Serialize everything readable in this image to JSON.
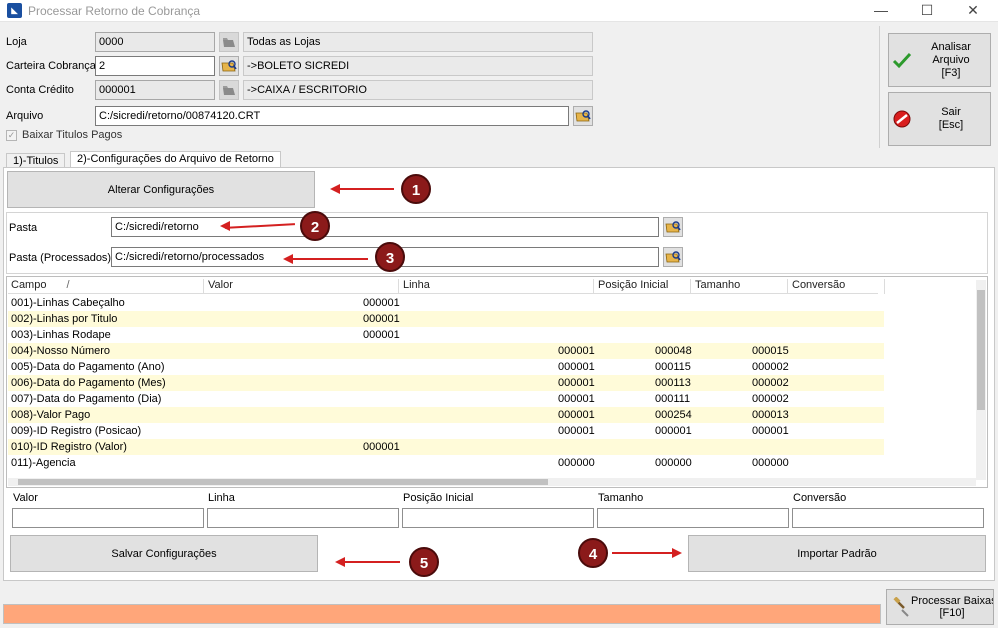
{
  "window": {
    "title": "Processar Retorno de Cobrança",
    "minimize": "—",
    "maximize": "☐",
    "close": "✕"
  },
  "header": {
    "loja_label": "Loja",
    "loja_code": "0000",
    "loja_name": "Todas as Lojas",
    "carteira_label": "Carteira Cobrança",
    "carteira_code": "2",
    "carteira_name": "->BOLETO SICREDI",
    "conta_label": "Conta Crédito",
    "conta_code": "000001",
    "conta_name": "->CAIXA / ESCRITORIO",
    "arquivo_label": "Arquivo",
    "arquivo_value": "C:/sicredi/retorno/00874120.CRT",
    "baixar_label": "Baixar Titulos Pagos"
  },
  "side": {
    "analisar_line1": "Analisar Arquivo",
    "analisar_line2": "[F3]",
    "sair_line1": "Sair",
    "sair_line2": "[Esc]",
    "processar_line1": "Processar Baixas",
    "processar_line2": "[F10]"
  },
  "tabs": [
    {
      "label": "1)-Titulos"
    },
    {
      "label": "2)-Configurações do Arquivo de Retorno"
    }
  ],
  "config": {
    "alterar_label": "Alterar Configurações",
    "pasta_label": "Pasta",
    "pasta_value": "C:/sicredi/retorno",
    "pasta_proc_label": "Pasta (Processados)",
    "pasta_proc_value": "C:/sicredi/retorno/processados",
    "salvar_label": "Salvar Configurações",
    "importar_label": "Importar Padrão"
  },
  "grid": {
    "columns": [
      "Campo",
      "Valor",
      "Linha",
      "Posição Inicial",
      "Tamanho",
      "Conversão"
    ],
    "sort_indicator": "/",
    "rows": [
      {
        "campo": "001)-Linhas Cabeçalho",
        "valor": "000001",
        "linha": "",
        "pos": "",
        "tam": ""
      },
      {
        "campo": "002)-Linhas por Titulo",
        "valor": "000001",
        "linha": "",
        "pos": "",
        "tam": ""
      },
      {
        "campo": "003)-Linhas Rodape",
        "valor": "000001",
        "linha": "",
        "pos": "",
        "tam": ""
      },
      {
        "campo": "004)-Nosso Número",
        "valor": "",
        "linha": "000001",
        "pos": "000048",
        "tam": "000015"
      },
      {
        "campo": "005)-Data do Pagamento (Ano)",
        "valor": "",
        "linha": "000001",
        "pos": "000115",
        "tam": "000002"
      },
      {
        "campo": "006)-Data do Pagamento (Mes)",
        "valor": "",
        "linha": "000001",
        "pos": "000113",
        "tam": "000002"
      },
      {
        "campo": "007)-Data do Pagamento (Dia)",
        "valor": "",
        "linha": "000001",
        "pos": "000111",
        "tam": "000002"
      },
      {
        "campo": "008)-Valor Pago",
        "valor": "",
        "linha": "000001",
        "pos": "000254",
        "tam": "000013"
      },
      {
        "campo": "009)-ID Registro (Posicao)",
        "valor": "",
        "linha": "000001",
        "pos": "000001",
        "tam": "000001"
      },
      {
        "campo": "010)-ID Registro (Valor)",
        "valor": "000001",
        "linha": "",
        "pos": "",
        "tam": ""
      },
      {
        "campo": "011)-Agencia",
        "valor": "",
        "linha": "000000",
        "pos": "000000",
        "tam": "000000"
      }
    ]
  },
  "edit_labels": [
    "Valor",
    "Linha",
    "Posição Inicial",
    "Tamanho",
    "Conversão"
  ],
  "annotations": [
    "1",
    "2",
    "3",
    "4",
    "5"
  ],
  "colors": {
    "accent_red": "#d42020",
    "progress": "#ffa67a",
    "alt_row": "#fffbd9"
  }
}
